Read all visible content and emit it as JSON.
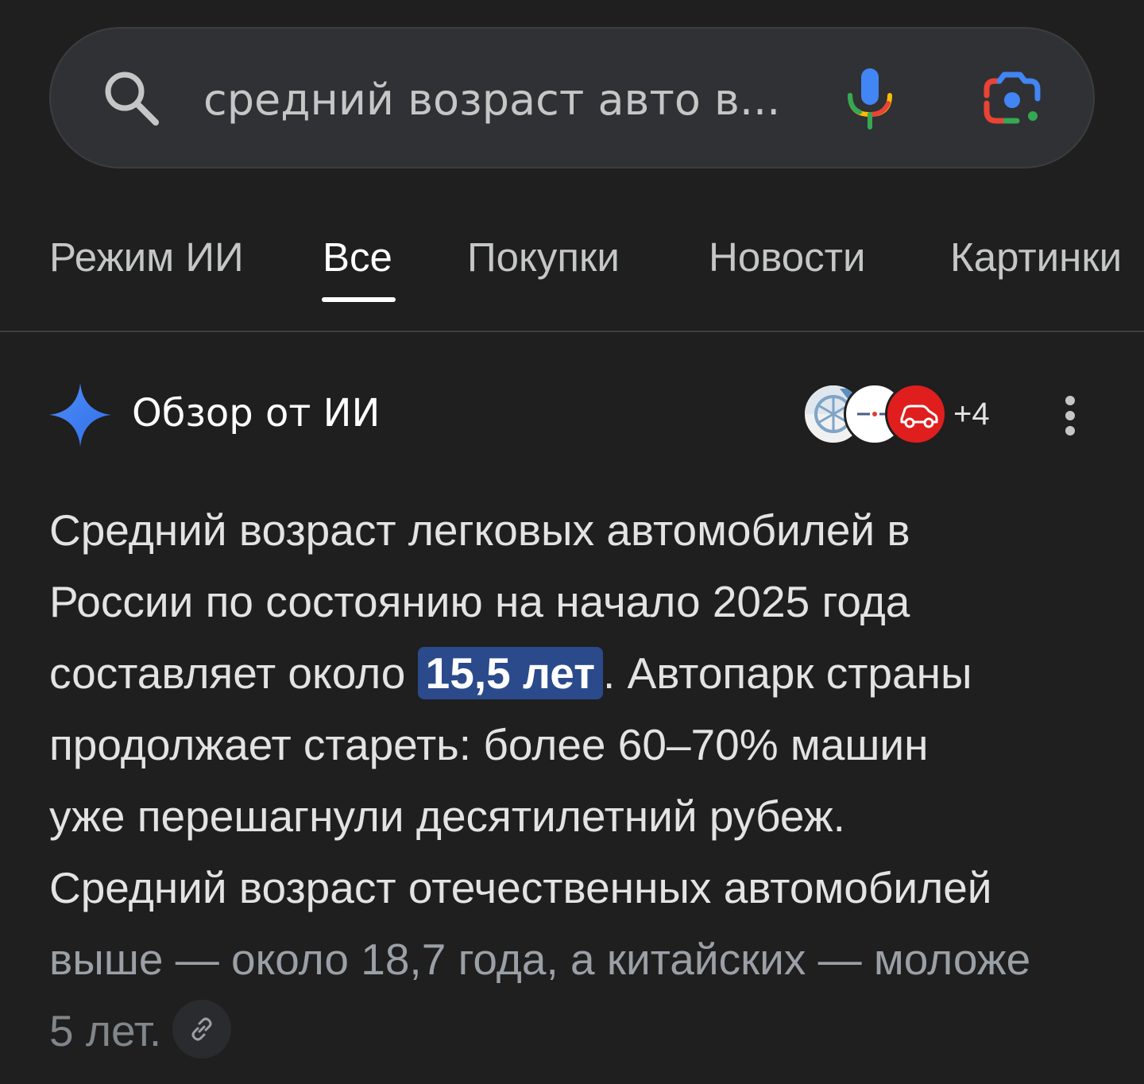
{
  "search": {
    "query": "средний возраст авто в..."
  },
  "tabs": [
    {
      "label": "Режим ИИ",
      "active": false
    },
    {
      "label": "Все",
      "active": true
    },
    {
      "label": "Покупки",
      "active": false
    },
    {
      "label": "Новости",
      "active": false
    },
    {
      "label": "Картинки",
      "active": false
    }
  ],
  "ai_overview": {
    "title": "Обзор от ИИ",
    "sources_more": "+4",
    "lines": [
      {
        "text": "Средний возраст легковых автомобилей в"
      },
      {
        "text": "России по состоянию на начало 2025 года"
      },
      {
        "before": "составляет около ",
        "highlight": "15,5 лет",
        "after": ". Автопарк страны"
      },
      {
        "text": "продолжает стареть: более 60–70% машин"
      },
      {
        "text": "уже перешагнули десятилетний рубеж."
      },
      {
        "text": "Средний возраст отечественных автомобилей"
      },
      {
        "text": "выше — около 18,7 года, а китайских — моложе"
      },
      {
        "text": "5 лет."
      }
    ]
  },
  "colors": {
    "background": "#1f1f1f",
    "highlight": "#2b4a8b",
    "google_blue": "#4285f4",
    "google_red": "#ea4335",
    "google_yellow": "#fbbc04",
    "google_green": "#34a853"
  }
}
